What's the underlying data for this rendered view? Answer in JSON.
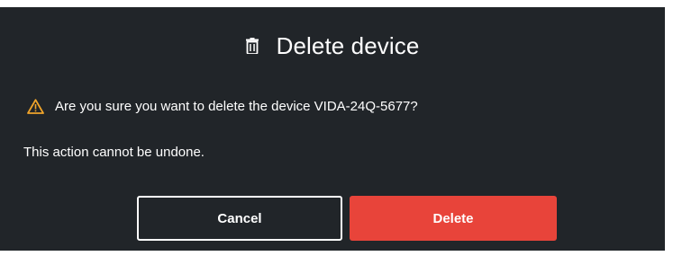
{
  "dialog": {
    "title": "Delete device",
    "title_icon": "trash-icon",
    "warning_icon": "warning-triangle-icon",
    "question": "Are you sure you want to delete the device VIDA-24Q-5677?",
    "note": "This action cannot be undone.",
    "cancel_label": "Cancel",
    "delete_label": "Delete"
  },
  "colors": {
    "dialog_background": "#212529",
    "delete_button": "#e8443a",
    "warning": "#f0a42a",
    "text": "#ffffff"
  }
}
